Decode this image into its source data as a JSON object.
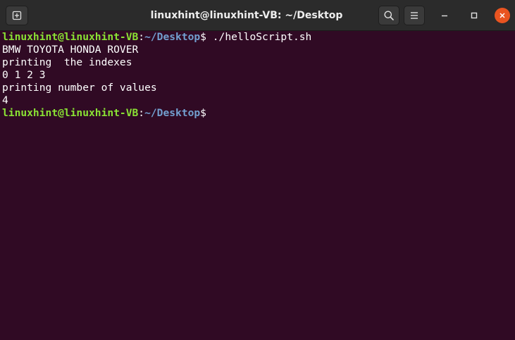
{
  "window": {
    "title": "linuxhint@linuxhint-VB: ~/Desktop"
  },
  "titlebar": {
    "icons": {
      "new_tab": "new-tab-icon",
      "search": "search-icon",
      "menu": "hamburger-menu-icon",
      "minimize": "minimize-icon",
      "maximize": "maximize-icon",
      "close": "close-icon"
    }
  },
  "colors": {
    "background": "#300a24",
    "titlebar": "#2b2b2b",
    "prompt_user": "#8ae234",
    "prompt_path": "#729fcf",
    "close_button": "#e95420"
  },
  "terminal": {
    "prompt_user": "linuxhint@linuxhint-VB",
    "prompt_colon": ":",
    "prompt_path": "~/Desktop",
    "prompt_symbol": "$",
    "command": " ./helloScript.sh",
    "output": [
      "BMW TOYOTA HONDA ROVER",
      "printing  the indexes",
      "0 1 2 3",
      "printing number of values",
      "4"
    ],
    "final_prompt_suffix": " "
  }
}
